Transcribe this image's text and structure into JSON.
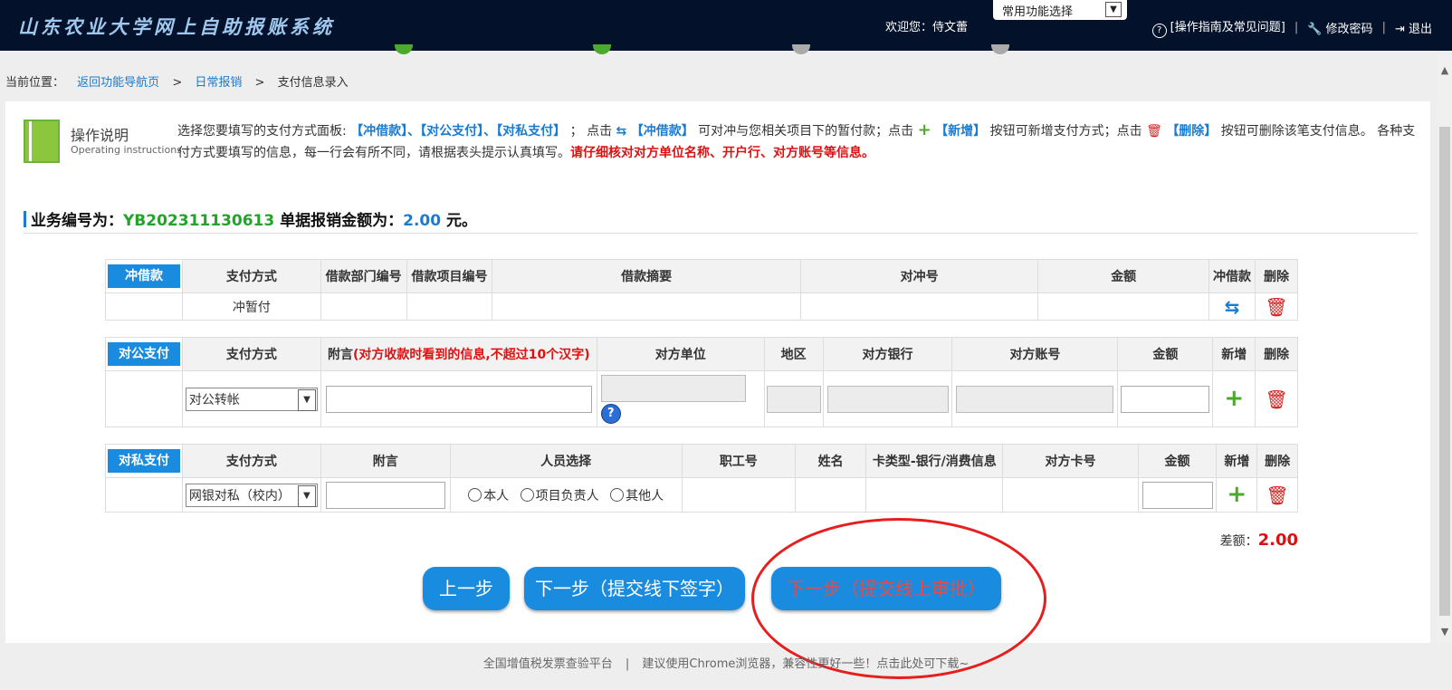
{
  "header": {
    "logo": "山东农业大学网上自助报账系统",
    "welcome": "欢迎您：侍文蕾",
    "quick_select": "常用功能选择",
    "guide": "[操作指南及常见问题]",
    "change_pwd": "修改密码",
    "logout": "退出",
    "sep": "|"
  },
  "breadcrumb": {
    "prefix": "当前位置：",
    "home": "返回功能导航页",
    "gt": ">",
    "daily": "日常报销",
    "current": "支付信息录入"
  },
  "instructions": {
    "title": "操作说明",
    "subtitle": "Operating instructions",
    "p1": "选择您要填写的支付方式面板:",
    "panels": "【冲借款】、【对公支付】、【对私支付】",
    "p2": "；  点击",
    "k_chong": "【冲借款】",
    "p3": "可对冲与您相关项目下的暂付款；点击",
    "k_add": "【新增】",
    "p4": "按钮可新增支付方式；点击",
    "k_del": "【删除】",
    "p5": "按钮可删除该笔支付信息。 各种支付方式要填写的信息，每一行会有所不同，请根据表头提示认真填写。",
    "warn": "请仔细核对对方单位名称、开户行、对方账号等信息。"
  },
  "business": {
    "label": "业务编号为：",
    "no": "YB202311130613",
    "amount_label": "单据报销金额为：",
    "amount": "2.00",
    "unit": "元。"
  },
  "loan_table": {
    "tag": "冲借款",
    "headers": [
      "支付方式",
      "借款部门编号",
      "借款项目编号",
      "借款摘要",
      "对冲号",
      "金额",
      "冲借款",
      "删除"
    ],
    "row": {
      "method": "冲暂付"
    }
  },
  "public_table": {
    "tag": "对公支付",
    "headers": [
      "支付方式",
      "附言",
      "对方单位",
      "地区",
      "对方银行",
      "对方账号",
      "金额",
      "新增",
      "删除"
    ],
    "note_hint": "(对方收款时看到的信息,不超过10个汉字)",
    "row": {
      "method": "对公转帐"
    }
  },
  "private_table": {
    "tag": "对私支付",
    "headers": [
      "支付方式",
      "附言",
      "人员选择",
      "职工号",
      "姓名",
      "卡类型-银行/消费信息",
      "对方卡号",
      "金额",
      "新增",
      "删除"
    ],
    "row": {
      "method": "网银对私（校内）",
      "radios": [
        "本人",
        "项目负责人",
        "其他人"
      ]
    }
  },
  "diff": {
    "label": "差额：",
    "value": "2.00"
  },
  "buttons": {
    "prev": "上一步",
    "next_offline": "下一步（提交线下签字）",
    "next_online": "下一步（提交线上审批）"
  },
  "footer": {
    "link1": "全国增值税发票查验平台",
    "sep": "|",
    "text": "建议使用Chrome浏览器，兼容性更好一些！点击此处可下载~"
  },
  "colors": {
    "header_bg": "#04112a",
    "accent_blue": "#1a8ce0",
    "green": "#22a32a",
    "red": "#e01010"
  }
}
